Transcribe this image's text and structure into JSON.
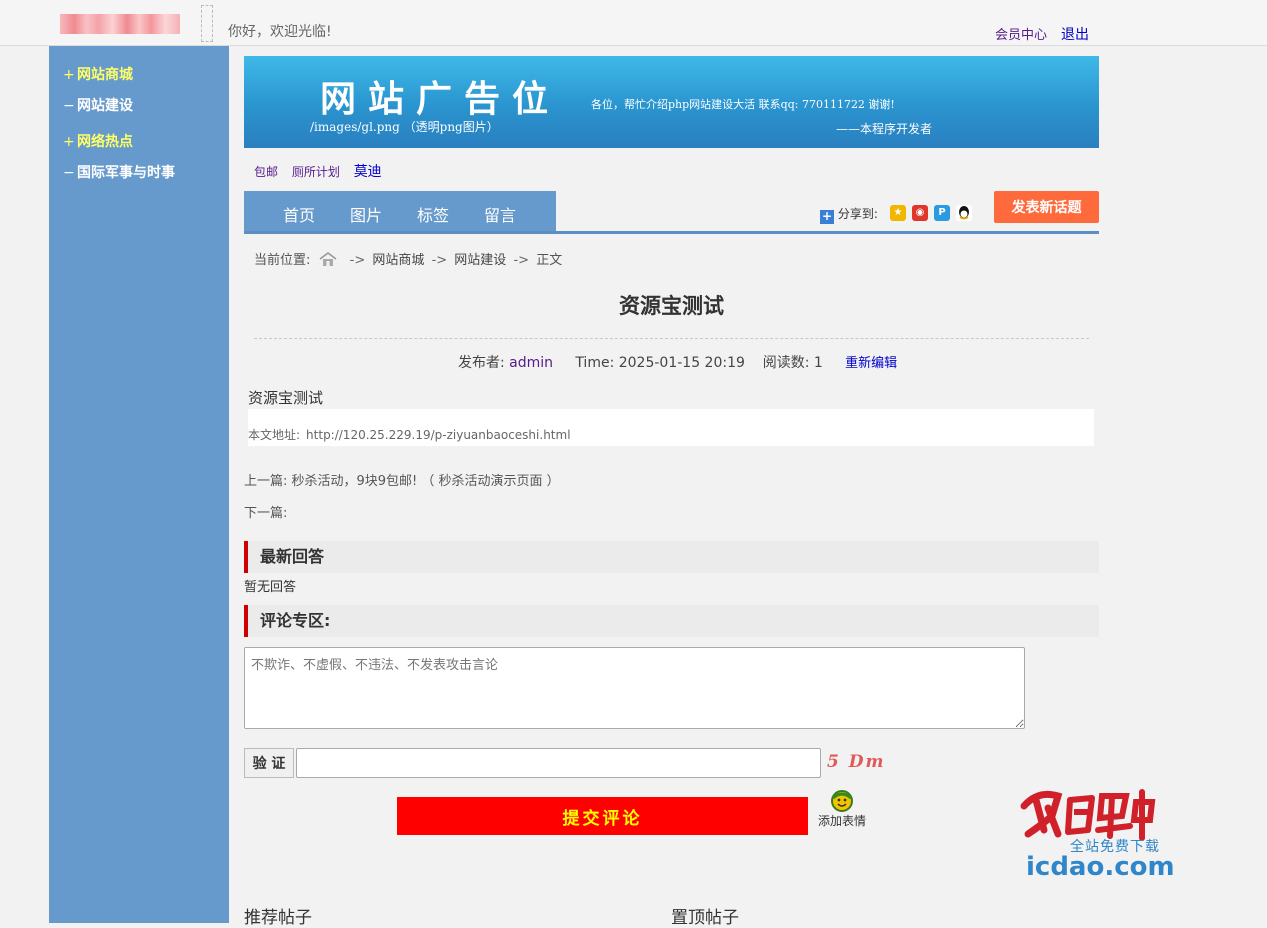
{
  "header": {
    "welcome": "你好，欢迎光临!",
    "member_center": "会员中心",
    "logout": "退出"
  },
  "sidebar": {
    "items": [
      {
        "mark": "+",
        "label": "网站商城",
        "color": "#ffff66"
      },
      {
        "mark": "−",
        "label": "网站建设",
        "color": "#ffffff"
      },
      {
        "mark": "+",
        "label": "网络热点",
        "color": "#ffff66"
      },
      {
        "mark": "−",
        "label": "国际军事与时事",
        "color": "#ffffff"
      }
    ]
  },
  "banner": {
    "title": "网站广告位",
    "path": "/images/gl.png （透明png图片）",
    "message": "各位，帮忙介绍php网站建设大活  联系qq: 770111722 谢谢!",
    "signature": "——本程序开发者"
  },
  "quick_links": [
    "包邮",
    "厕所计划",
    "莫迪"
  ],
  "nav": {
    "items": [
      "首页",
      "图片",
      "标签",
      "留言"
    ],
    "share_label": "分享到:",
    "post_button": "发表新话题"
  },
  "breadcrumb": {
    "prefix": "当前位置:",
    "items": [
      "网站商城",
      "网站建设",
      "正文"
    ]
  },
  "article": {
    "title": "资源宝测试",
    "author_label": "发布者:",
    "author": "admin",
    "time": "Time: 2025-01-15 20:19",
    "views": "阅读数: 1",
    "edit": "重新编辑",
    "content": "资源宝测试",
    "address_label": "本文地址:",
    "address_url": "http://120.25.229.19/p-ziyuanbaoceshi.html",
    "prev": "上一篇: 秒杀活动，9块9包邮! （ 秒杀活动演示页面 ）",
    "next": "下一篇:"
  },
  "replies": {
    "heading": "最新回答",
    "empty": "暂无回答"
  },
  "comment": {
    "heading": "评论专区:",
    "placeholder": "不欺诈、不虚假、不违法、不发表攻击言论",
    "verify_label": "验 证",
    "captcha": "5 Dm",
    "submit": "提交评论",
    "emoji": "添加表情"
  },
  "watermark": {
    "subtitle": "全站免费下载",
    "site": "icdao.com"
  },
  "bottom": {
    "recommended": "推荐帖子",
    "pinned": "置顶帖子"
  },
  "colors": {
    "sidebar": "#6699cc",
    "accent_red": "#cc0000",
    "submit_bg": "#ff0000",
    "post_button_bg": "#ff6a3d"
  }
}
